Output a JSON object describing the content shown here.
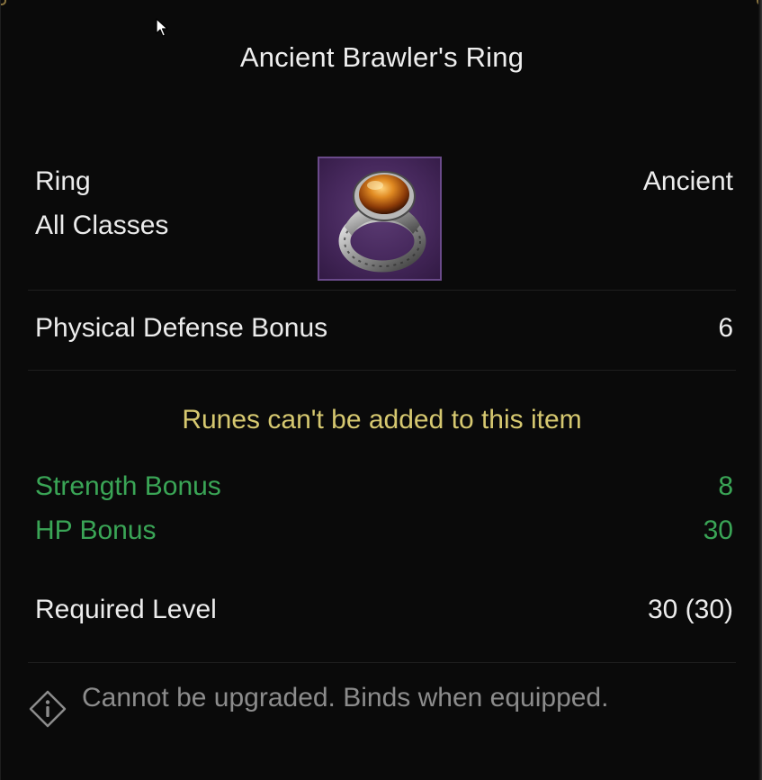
{
  "item": {
    "name": "Ancient Brawler's Ring",
    "type": "Ring",
    "classes": "All Classes",
    "grade": "Ancient",
    "icon": "ring-icon"
  },
  "stats": {
    "physical_defense_label": "Physical Defense Bonus",
    "physical_defense_value": "6"
  },
  "runes_message": "Runes can't be added to this item",
  "bonuses": [
    {
      "label": "Strength Bonus",
      "value": "8"
    },
    {
      "label": "HP Bonus",
      "value": "30"
    }
  ],
  "requirement": {
    "label": "Required Level",
    "value": "30 (30)"
  },
  "footer_note": "Cannot be upgraded. Binds when equipped.",
  "colors": {
    "background": "#0a0a0a",
    "text": "#ececec",
    "bonus_green": "#3aa556",
    "rune_yellow": "#d6c870",
    "note_grey": "#8c8c8c",
    "icon_frame_purple": "#6a4a8a"
  }
}
